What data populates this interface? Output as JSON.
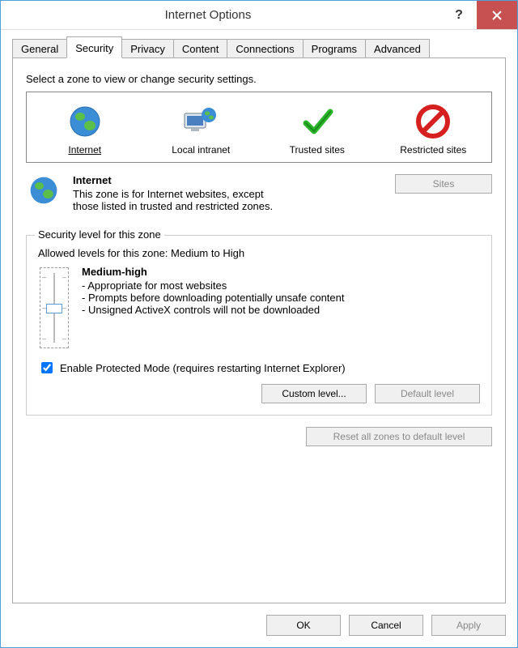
{
  "title": "Internet Options",
  "tabs": [
    "General",
    "Security",
    "Privacy",
    "Content",
    "Connections",
    "Programs",
    "Advanced"
  ],
  "active_tab": 1,
  "zone_instruction": "Select a zone to view or change security settings.",
  "zones": [
    {
      "name": "Internet",
      "icon": "globe"
    },
    {
      "name": "Local intranet",
      "icon": "computer"
    },
    {
      "name": "Trusted sites",
      "icon": "check"
    },
    {
      "name": "Restricted sites",
      "icon": "restricted"
    }
  ],
  "selected_zone": 0,
  "zone_detail": {
    "name": "Internet",
    "description": "This zone is for Internet websites, except those listed in trusted and restricted zones."
  },
  "sites_button": "Sites",
  "sites_enabled": false,
  "security_group_label": "Security level for this zone",
  "allowed_levels_label": "Allowed levels for this zone: Medium to High",
  "level": {
    "name": "Medium-high",
    "bullets": [
      "Appropriate for most websites",
      "Prompts before downloading potentially unsafe content",
      "Unsigned ActiveX controls will not be downloaded"
    ]
  },
  "protected_mode": {
    "checked": true,
    "label": "Enable Protected Mode (requires restarting Internet Explorer)"
  },
  "custom_level_button": "Custom level...",
  "default_level_button": "Default level",
  "default_level_enabled": false,
  "reset_button": "Reset all zones to default level",
  "reset_enabled": false,
  "footer": {
    "ok": "OK",
    "cancel": "Cancel",
    "apply": "Apply"
  },
  "apply_enabled": false
}
